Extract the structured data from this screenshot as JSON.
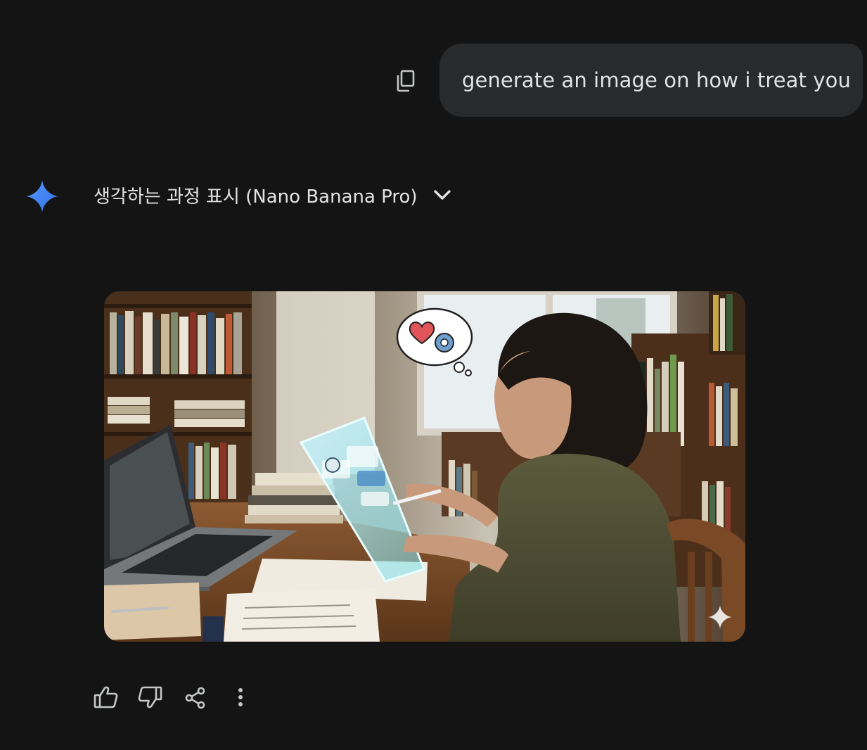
{
  "user_message": {
    "text": "generate an image on how i treat you"
  },
  "response": {
    "thinking_toggle": {
      "label": "생각하는 과정 표시 (Nano Banana Pro)"
    },
    "generated_image": {
      "subject": "woman-using-holographic-tablet"
    }
  },
  "icons": {
    "copy": "copy-icon",
    "assistant": "sparkle-icon",
    "expand": "chevron-down-icon",
    "like": "thumbs-up-icon",
    "dislike": "thumbs-down-icon",
    "share": "share-icon",
    "more": "more-vert-icon"
  },
  "colors": {
    "background": "#141415",
    "bubble": "#282a2c",
    "text": "#e3e3e3",
    "accent_blue": "#4a86f0"
  }
}
